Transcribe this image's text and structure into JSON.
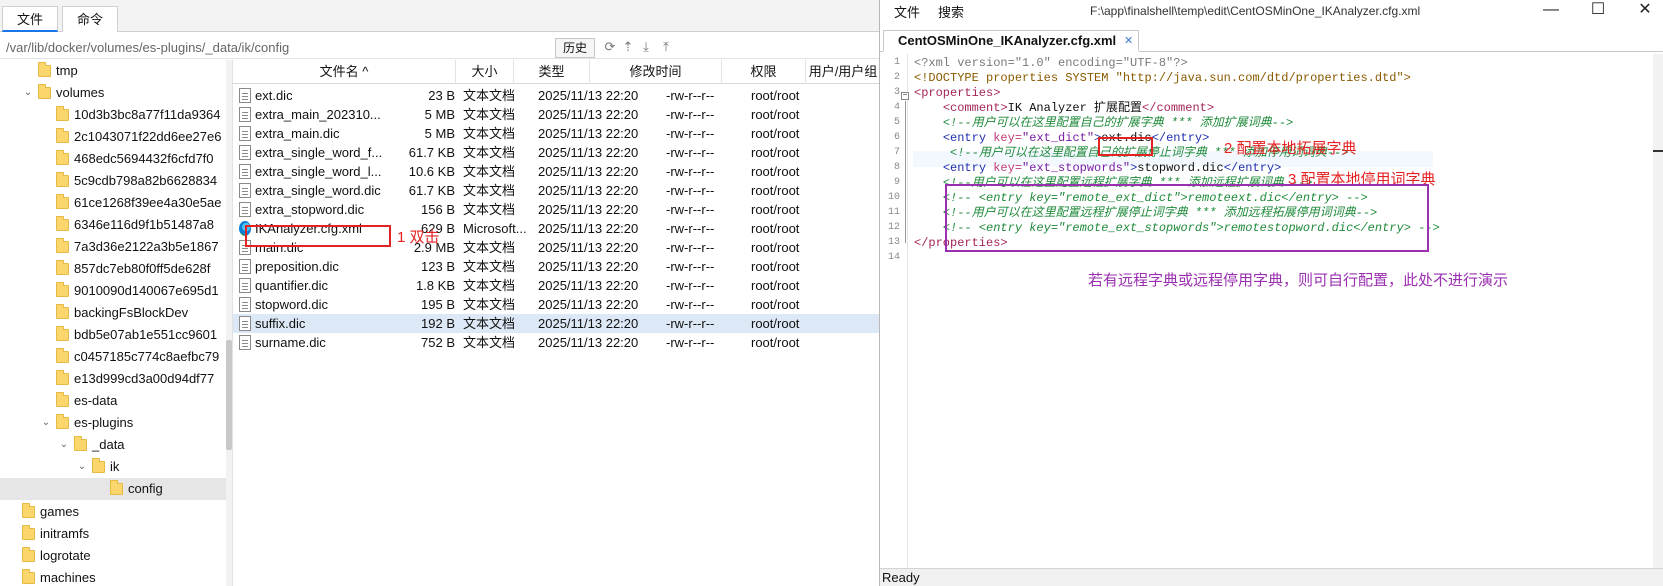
{
  "left": {
    "tabs": [
      "文件",
      "命令"
    ],
    "path": "/var/lib/docker/volumes/es-plugins/_data/ik/config",
    "history_label": "历史",
    "toolbar_icons": [
      "refresh-icon",
      "up-icon",
      "download-icon",
      "upload-icon"
    ],
    "tree": [
      {
        "label": "tmp",
        "depth": 0,
        "arrow": ""
      },
      {
        "label": "volumes",
        "depth": 0,
        "arrow": "v"
      },
      {
        "label": "10d3b3bc8a77f11da9364",
        "depth": 1,
        "arrow": ""
      },
      {
        "label": "2c1043071f22dd6ee27e6",
        "depth": 1,
        "arrow": ""
      },
      {
        "label": "468edc5694432f6cfd7f0",
        "depth": 1,
        "arrow": ""
      },
      {
        "label": "5c9cdb798a82b6628834",
        "depth": 1,
        "arrow": ""
      },
      {
        "label": "61ce1268f39ee4a30e5ae",
        "depth": 1,
        "arrow": ""
      },
      {
        "label": "6346e116d9f1b51487a8",
        "depth": 1,
        "arrow": ""
      },
      {
        "label": "7a3d36e2122a3b5e1867",
        "depth": 1,
        "arrow": ""
      },
      {
        "label": "857dc7eb80f0ff5de628f",
        "depth": 1,
        "arrow": ""
      },
      {
        "label": "9010090d140067e695d1",
        "depth": 1,
        "arrow": ""
      },
      {
        "label": "backingFsBlockDev",
        "depth": 1,
        "arrow": ""
      },
      {
        "label": "bdb5e07ab1e551cc9601",
        "depth": 1,
        "arrow": ""
      },
      {
        "label": "c0457185c774c8aefbc79",
        "depth": 1,
        "arrow": ""
      },
      {
        "label": "e13d999cd3a00d94df77",
        "depth": 1,
        "arrow": ""
      },
      {
        "label": "es-data",
        "depth": 1,
        "arrow": ""
      },
      {
        "label": "es-plugins",
        "depth": 1,
        "arrow": "v"
      },
      {
        "label": "_data",
        "depth": 2,
        "arrow": "v"
      },
      {
        "label": "ik",
        "depth": 3,
        "arrow": "v"
      },
      {
        "label": "config",
        "depth": 4,
        "arrow": ""
      },
      {
        "label": "games",
        "depth": -1,
        "arrow": ""
      },
      {
        "label": "initramfs",
        "depth": -1,
        "arrow": ""
      },
      {
        "label": "logrotate",
        "depth": -1,
        "arrow": ""
      },
      {
        "label": "machines",
        "depth": -1,
        "arrow": ""
      }
    ],
    "columns": [
      "文件名 ^",
      "大小",
      "类型",
      "修改时间",
      "权限",
      "用户/用户组"
    ],
    "files": [
      {
        "name": "ext.dic",
        "size": "23 B",
        "type": "文本文档",
        "mtime": "2025/11/13 22:20",
        "perm": "-rw-r--r--",
        "owner": "root/root",
        "icon": "file"
      },
      {
        "name": "extra_main_202310...",
        "size": "5 MB",
        "type": "文本文档",
        "mtime": "2025/11/13 22:20",
        "perm": "-rw-r--r--",
        "owner": "root/root",
        "icon": "file"
      },
      {
        "name": "extra_main.dic",
        "size": "5 MB",
        "type": "文本文档",
        "mtime": "2025/11/13 22:20",
        "perm": "-rw-r--r--",
        "owner": "root/root",
        "icon": "file"
      },
      {
        "name": "extra_single_word_f...",
        "size": "61.7 KB",
        "type": "文本文档",
        "mtime": "2025/11/13 22:20",
        "perm": "-rw-r--r--",
        "owner": "root/root",
        "icon": "file"
      },
      {
        "name": "extra_single_word_l...",
        "size": "10.6 KB",
        "type": "文本文档",
        "mtime": "2025/11/13 22:20",
        "perm": "-rw-r--r--",
        "owner": "root/root",
        "icon": "file"
      },
      {
        "name": "extra_single_word.dic",
        "size": "61.7 KB",
        "type": "文本文档",
        "mtime": "2025/11/13 22:20",
        "perm": "-rw-r--r--",
        "owner": "root/root",
        "icon": "file"
      },
      {
        "name": "extra_stopword.dic",
        "size": "156 B",
        "type": "文本文档",
        "mtime": "2025/11/13 22:20",
        "perm": "-rw-r--r--",
        "owner": "root/root",
        "icon": "file"
      },
      {
        "name": "IKAnalyzer.cfg.xml",
        "size": "629 B",
        "type": "Microsoft...",
        "mtime": "2025/11/13 22:20",
        "perm": "-rw-r--r--",
        "owner": "root/root",
        "icon": "edge"
      },
      {
        "name": "main.dic",
        "size": "2.9 MB",
        "type": "文本文档",
        "mtime": "2025/11/13 22:20",
        "perm": "-rw-r--r--",
        "owner": "root/root",
        "icon": "file"
      },
      {
        "name": "preposition.dic",
        "size": "123 B",
        "type": "文本文档",
        "mtime": "2025/11/13 22:20",
        "perm": "-rw-r--r--",
        "owner": "root/root",
        "icon": "file"
      },
      {
        "name": "quantifier.dic",
        "size": "1.8 KB",
        "type": "文本文档",
        "mtime": "2025/11/13 22:20",
        "perm": "-rw-r--r--",
        "owner": "root/root",
        "icon": "file"
      },
      {
        "name": "stopword.dic",
        "size": "195 B",
        "type": "文本文档",
        "mtime": "2025/11/13 22:20",
        "perm": "-rw-r--r--",
        "owner": "root/root",
        "icon": "file"
      },
      {
        "name": "suffix.dic",
        "size": "192 B",
        "type": "文本文档",
        "mtime": "2025/11/13 22:20",
        "perm": "-rw-r--r--",
        "owner": "root/root",
        "icon": "file",
        "selected": true
      },
      {
        "name": "surname.dic",
        "size": "752 B",
        "type": "文本文档",
        "mtime": "2025/11/13 22:20",
        "perm": "-rw-r--r--",
        "owner": "root/root",
        "icon": "file"
      }
    ]
  },
  "right": {
    "menus": [
      "文件",
      "搜索"
    ],
    "title_path": "F:\\app\\finalshell\\temp\\edit\\CentOSMinOne_IKAnalyzer.cfg.xml",
    "window_controls": [
      "—",
      "☐",
      "✕"
    ],
    "tab_label": "CentOSMinOne_IKAnalyzer.cfg.xml",
    "tab_close": "✕",
    "line_numbers": [
      "1",
      "2",
      "3",
      "4",
      "5",
      "6",
      "7",
      "8",
      "9",
      "10",
      "11",
      "12",
      "13",
      "14"
    ],
    "code": [
      [
        {
          "c": "t-pi",
          "t": "<?xml version=\"1.0\" encoding=\"UTF-8\"?>"
        }
      ],
      [
        {
          "c": "t-dt",
          "t": "<!DOCTYPE properties SYSTEM \"http://java.sun.com/dtd/properties.dtd\">"
        }
      ],
      [
        {
          "c": "t-tag",
          "t": "<properties>"
        }
      ],
      [
        {
          "c": "t-text",
          "t": "    "
        },
        {
          "c": "t-tag",
          "t": "<comment>"
        },
        {
          "c": "t-text",
          "t": "IK Analyzer 扩展配置"
        },
        {
          "c": "t-tag",
          "t": "</comment>"
        }
      ],
      [
        {
          "c": "t-text",
          "t": "    "
        },
        {
          "c": "t-cmt",
          "t": "<!--用户可以在这里配置自己的扩展字典 *** 添加扩展词典-->"
        }
      ],
      [
        {
          "c": "t-text",
          "t": "    "
        },
        {
          "c": "t-blue",
          "t": "<entry "
        },
        {
          "c": "t-attr",
          "t": "key="
        },
        {
          "c": "t-val",
          "t": "\"ext_dict\""
        },
        {
          "c": "t-blue",
          "t": ">"
        },
        {
          "c": "t-text",
          "t": "ext.dic"
        },
        {
          "c": "t-blue",
          "t": "</entry>"
        }
      ],
      [
        {
          "c": "t-text",
          "t": "     "
        },
        {
          "c": "t-cmt",
          "t": "<!--用户可以在这里配置自己的扩展停止词字典 *** 添加停用词词典-->"
        }
      ],
      [
        {
          "c": "t-text",
          "t": "    "
        },
        {
          "c": "t-blue",
          "t": "<entry "
        },
        {
          "c": "t-attr",
          "t": "key="
        },
        {
          "c": "t-val",
          "t": "\"ext_stopwords\""
        },
        {
          "c": "t-blue",
          "t": ">"
        },
        {
          "c": "t-text",
          "t": "stopword.dic"
        },
        {
          "c": "t-blue",
          "t": "</entry>"
        }
      ],
      [
        {
          "c": "t-text",
          "t": "    "
        },
        {
          "c": "t-cmt",
          "t": "<!--用户可以在这里配置远程扩展字典 *** 添加远程扩展词典 -->"
        }
      ],
      [
        {
          "c": "t-text",
          "t": "    "
        },
        {
          "c": "t-cmt",
          "t": "<!-- <entry key=\"remote_ext_dict\">remoteext.dic</entry> -->"
        }
      ],
      [
        {
          "c": "t-text",
          "t": "    "
        },
        {
          "c": "t-cmt",
          "t": "<!--用户可以在这里配置远程扩展停止词字典 *** 添加远程拓展停用词词典-->"
        }
      ],
      [
        {
          "c": "t-text",
          "t": "    "
        },
        {
          "c": "t-cmt",
          "t": "<!-- <entry key=\"remote_ext_stopwords\">remotestopword.dic</entry> -->"
        }
      ],
      [
        {
          "c": "t-tag",
          "t": "</properties>"
        }
      ],
      []
    ],
    "status": "Ready"
  },
  "annotations": {
    "double_click": "1 双击",
    "local_ext": "2  配置本地拓展字典",
    "local_stop": "3  配置本地停用词字典",
    "remote_note": "若有远程字典或远程停用字典，则可自行配置，此处不进行演示"
  },
  "colors": {
    "annotation_red": "#e52222",
    "annotation_purple": "#9a2fb0",
    "selected_row": "#dce8f5"
  }
}
